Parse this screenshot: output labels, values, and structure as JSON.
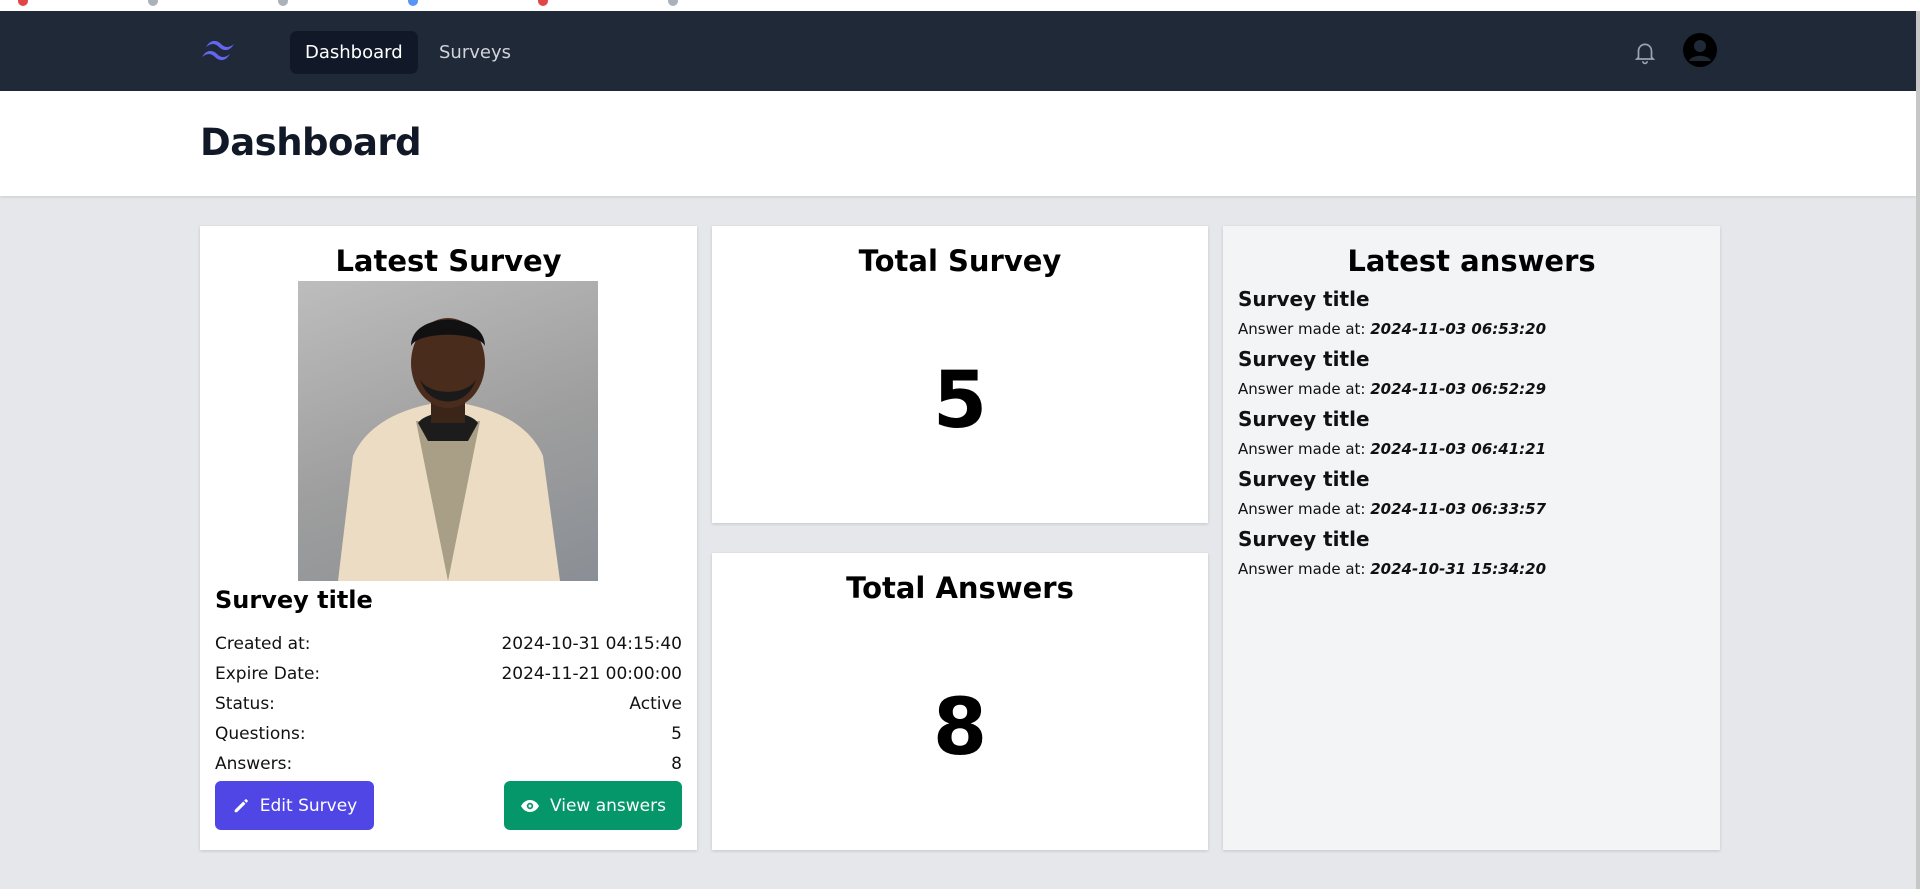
{
  "nav": {
    "items": [
      {
        "label": "Dashboard",
        "active": true
      },
      {
        "label": "Surveys",
        "active": false
      }
    ]
  },
  "page_title": "Dashboard",
  "latest_survey": {
    "heading": "Latest Survey",
    "title": "Survey title",
    "details": [
      {
        "label": "Created at:",
        "value": "2024-10-31 04:15:40"
      },
      {
        "label": "Expire Date:",
        "value": "2024-11-21 00:00:00"
      },
      {
        "label": "Status:",
        "value": "Active"
      },
      {
        "label": "Questions:",
        "value": "5"
      },
      {
        "label": "Answers:",
        "value": "8"
      }
    ],
    "edit_label": "Edit Survey",
    "view_label": "View answers"
  },
  "total_survey": {
    "heading": "Total Survey",
    "value": "5"
  },
  "total_answers": {
    "heading": "Total Answers",
    "value": "8"
  },
  "latest_answers": {
    "heading": "Latest answers",
    "items": [
      {
        "title": "Survey title",
        "label": "Answer made at:",
        "date": "2024-11-03 06:53:20"
      },
      {
        "title": "Survey title",
        "label": "Answer made at:",
        "date": "2024-11-03 06:52:29"
      },
      {
        "title": "Survey title",
        "label": "Answer made at:",
        "date": "2024-11-03 06:41:21"
      },
      {
        "title": "Survey title",
        "label": "Answer made at:",
        "date": "2024-11-03 06:33:57"
      },
      {
        "title": "Survey title",
        "label": "Answer made at:",
        "date": "2024-10-31 15:34:20"
      }
    ]
  },
  "colors": {
    "navbar": "#1f2937",
    "edit_button": "#4f46e5",
    "view_button": "#059669",
    "logo": "#6366f1"
  },
  "icons": {
    "logo": "tailwind-logo-icon",
    "notifications": "bell-icon",
    "profile": "user-circle-icon",
    "edit": "pencil-icon",
    "view": "eye-icon"
  }
}
